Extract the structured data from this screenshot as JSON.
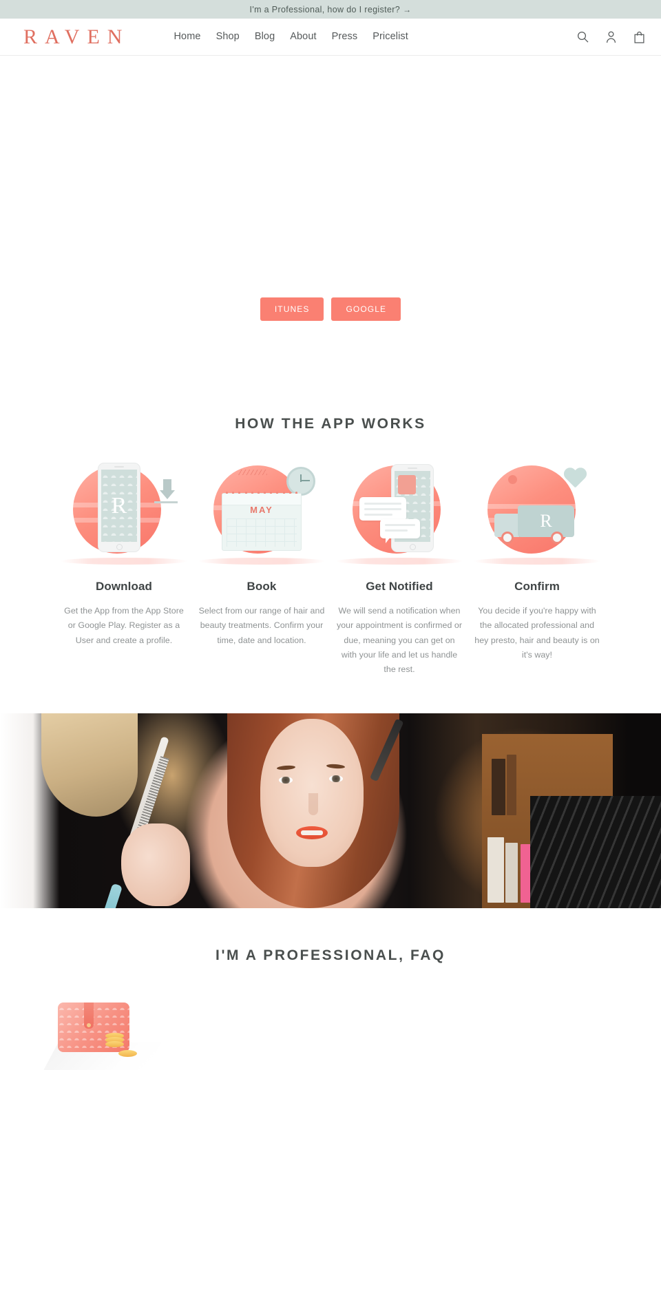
{
  "announcement": {
    "text": "I'm a Professional, how do I register?",
    "arrow": "→",
    "background": "#d4dedb"
  },
  "header": {
    "logo": "RAVEN",
    "logo_color": "#e06f60",
    "nav": [
      {
        "label": "Home",
        "name": "nav-home"
      },
      {
        "label": "Shop",
        "name": "nav-shop"
      },
      {
        "label": "Blog",
        "name": "nav-blog"
      },
      {
        "label": "About",
        "name": "nav-about"
      },
      {
        "label": "Press",
        "name": "nav-press"
      },
      {
        "label": "Pricelist",
        "name": "nav-pricelist"
      }
    ],
    "icons": [
      {
        "name": "search-icon",
        "label": "Search"
      },
      {
        "name": "account-icon",
        "label": "Log in"
      },
      {
        "name": "cart-icon",
        "label": "Cart"
      }
    ]
  },
  "hero": {
    "buttons": [
      {
        "label": "ITUNES",
        "name": "itunes-button"
      },
      {
        "label": "GOOGLE",
        "name": "google-button"
      }
    ],
    "button_color": "#fa8072"
  },
  "how_section": {
    "title": "HOW THE APP WORKS",
    "features": [
      {
        "title": "Download",
        "text": "Get the App from the App Store or Google Play. Register as a User and create a profile.",
        "art": "phone-download-icon"
      },
      {
        "title": "Book",
        "text": "Select from our range of hair and beauty treatments. Confirm your time, date and location.",
        "art": "calendar-clock-icon",
        "calendar_month": "MAY"
      },
      {
        "title": "Get Notified",
        "text": "We will send a notification when your appointment is confirmed or due, meaning you can get on with your life and let us handle the rest.",
        "art": "phone-notification-icon"
      },
      {
        "title": "Confirm",
        "text": "You decide if you're happy with the allocated professional and hey presto, hair and beauty is on it's way!",
        "art": "delivery-van-heart-icon"
      }
    ]
  },
  "photo_banner": {
    "alt": "Woman having her hair brushed and makeup applied by two stylists"
  },
  "faq_section": {
    "title": "I'M A PROFESSIONAL, FAQ",
    "art": "wallet-coins-icon"
  },
  "brand": {
    "accent": "#fa8072",
    "logo_red": "#e06f60",
    "heading_gray": "#4a4f4e",
    "body_gray": "#8e9293",
    "announcement_bg": "#d4dedb"
  }
}
